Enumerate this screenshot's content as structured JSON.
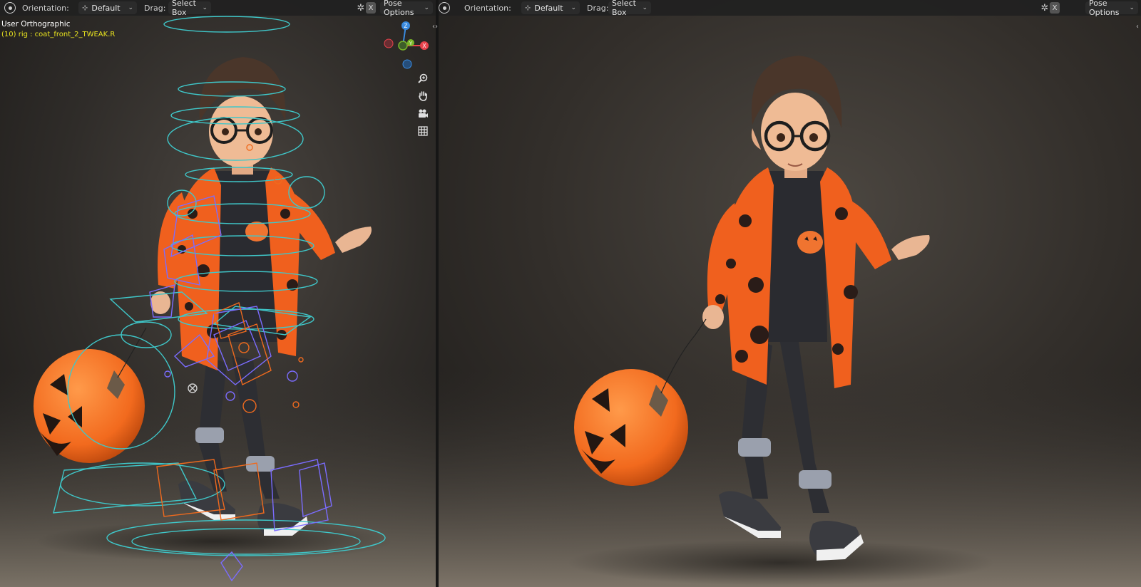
{
  "left_viewport": {
    "header": {
      "orientation_label": "Orientation:",
      "orientation_value": "Default",
      "drag_label": "Drag:",
      "drag_value": "Select Box",
      "x_button": "X",
      "pose_options": "Pose Options"
    },
    "overlay": {
      "view_name": "User Orthographic",
      "active_object": "(10) rig : coat_front_2_TWEAK.R"
    },
    "gizmo": {
      "z": "Z",
      "y": "Y",
      "x": "X"
    },
    "nav_icons": [
      "zoom-icon",
      "hand-pan-icon",
      "camera-icon",
      "grid-icon"
    ]
  },
  "right_viewport": {
    "header": {
      "orientation_label": "Orientation:",
      "orientation_value": "Default",
      "drag_label": "Drag:",
      "drag_value": "Select Box",
      "x_button": "X",
      "pose_options": "Pose Options"
    }
  },
  "colors": {
    "header_bg": "#212121",
    "active_text": "#e8e31f",
    "gizmo_x": "#e8424c",
    "gizmo_y": "#7ab829",
    "gizmo_z": "#3a8be0",
    "rig_cyan": "#3fc7c9",
    "rig_purple": "#7b6cff",
    "rig_orange": "#ef6a1e",
    "coat_orange": "#f26522"
  }
}
